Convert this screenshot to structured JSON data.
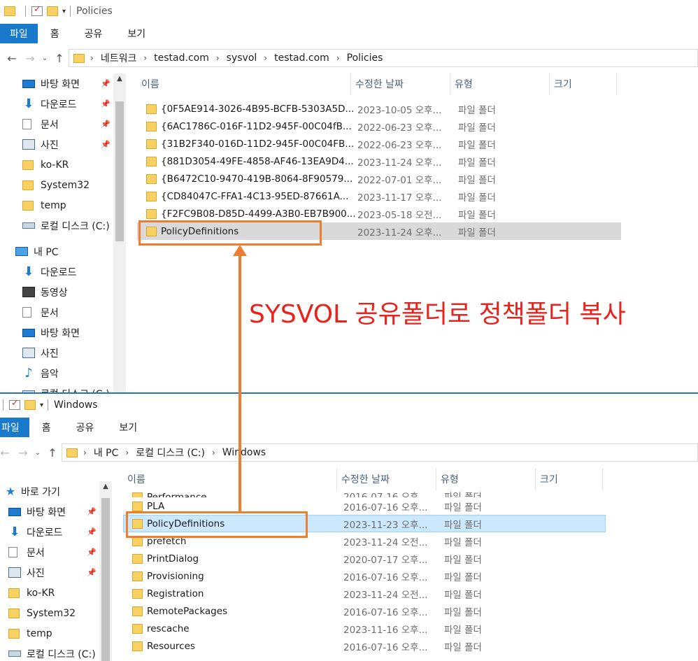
{
  "top": {
    "title": "Policies",
    "ribbon_tabs": [
      "파일",
      "홈",
      "공유",
      "보기"
    ],
    "breadcrumb": [
      "네트워크",
      "testad.com",
      "sysvol",
      "testad.com",
      "Policies"
    ],
    "sidebar": [
      {
        "label": "바탕 화면",
        "icon": "desktop-icon",
        "pinned": true
      },
      {
        "label": "다운로드",
        "icon": "download-icon",
        "pinned": true
      },
      {
        "label": "문서",
        "icon": "document-icon",
        "pinned": true
      },
      {
        "label": "사진",
        "icon": "pictures-icon",
        "pinned": true
      },
      {
        "label": "ko-KR",
        "icon": "folder-icon",
        "pinned": false
      },
      {
        "label": "System32",
        "icon": "folder-icon",
        "pinned": false
      },
      {
        "label": "temp",
        "icon": "folder-icon",
        "pinned": false
      },
      {
        "label": "로컬 디스크 (C:)",
        "icon": "drive-icon",
        "pinned": false
      },
      {
        "label": "내 PC",
        "icon": "pc-icon",
        "pinned": false
      },
      {
        "label": "다운로드",
        "icon": "download-icon",
        "pinned": false
      },
      {
        "label": "동영상",
        "icon": "video-icon",
        "pinned": false
      },
      {
        "label": "문서",
        "icon": "document-icon",
        "pinned": false
      },
      {
        "label": "바탕 화면",
        "icon": "desktop-icon",
        "pinned": false
      },
      {
        "label": "사진",
        "icon": "pictures-icon",
        "pinned": false
      },
      {
        "label": "음악",
        "icon": "music-icon",
        "pinned": false
      },
      {
        "label": "로컬 디스크 (C:)",
        "icon": "drive-icon",
        "pinned": false
      }
    ],
    "columns": [
      "이름",
      "수정한 날짜",
      "유형",
      "크기"
    ],
    "rows": [
      {
        "name": "{0F5AE914-3026-4B95-BCFB-5303A5D...",
        "date": "2023-10-05 오후...",
        "type": "파일 폴더"
      },
      {
        "name": "{6AC1786C-016F-11D2-945F-00C04fB...",
        "date": "2022-06-23 오후...",
        "type": "파일 폴더"
      },
      {
        "name": "{31B2F340-016D-11D2-945F-00C04FB...",
        "date": "2022-06-23 오후...",
        "type": "파일 폴더"
      },
      {
        "name": "{881D3054-49FE-4858-AF46-13EA9D4...",
        "date": "2023-11-24 오후...",
        "type": "파일 폴더"
      },
      {
        "name": "{B6472C10-9470-419B-8064-8F90579...",
        "date": "2022-07-01 오후...",
        "type": "파일 폴더"
      },
      {
        "name": "{CD84047C-FFA1-4C13-95ED-87661A...",
        "date": "2023-11-17 오후...",
        "type": "파일 폴더"
      },
      {
        "name": "{F2FC9B08-D85D-4499-A3B0-EB7B900...",
        "date": "2023-05-18 오전...",
        "type": "파일 폴더"
      },
      {
        "name": "PolicyDefinitions",
        "date": "2023-11-24 오후...",
        "type": "파일 폴더",
        "selected": true
      }
    ]
  },
  "bottom": {
    "title": "Windows",
    "ribbon_tabs": [
      "파일",
      "홈",
      "공유",
      "보기"
    ],
    "breadcrumb": [
      "내 PC",
      "로컬 디스크 (C:)",
      "Windows"
    ],
    "sidebar": [
      {
        "label": "바로 가기",
        "icon": "star-icon",
        "pinned": false
      },
      {
        "label": "바탕 화면",
        "icon": "desktop-icon",
        "pinned": true
      },
      {
        "label": "다운로드",
        "icon": "download-icon",
        "pinned": true
      },
      {
        "label": "문서",
        "icon": "document-icon",
        "pinned": true
      },
      {
        "label": "사진",
        "icon": "pictures-icon",
        "pinned": true
      },
      {
        "label": "ko-KR",
        "icon": "folder-icon",
        "pinned": false
      },
      {
        "label": "System32",
        "icon": "folder-icon",
        "pinned": false
      },
      {
        "label": "temp",
        "icon": "folder-icon",
        "pinned": false
      },
      {
        "label": "로컬 디스크 (C:)",
        "icon": "drive-icon",
        "pinned": false
      }
    ],
    "columns": [
      "이름",
      "수정한 날짜",
      "유형",
      "크기"
    ],
    "rows": [
      {
        "name": "Performance",
        "date": "2016-07-16 오후...",
        "type": "파일 폴더",
        "partial": true
      },
      {
        "name": "PLA",
        "date": "2016-07-16 오후...",
        "type": "파일 폴더"
      },
      {
        "name": "PolicyDefinitions",
        "date": "2023-11-23 오후...",
        "type": "파일 폴더",
        "selected": true
      },
      {
        "name": "prefetch",
        "date": "2023-11-24 오전...",
        "type": "파일 폴더"
      },
      {
        "name": "PrintDialog",
        "date": "2020-07-17 오후...",
        "type": "파일 폴더"
      },
      {
        "name": "Provisioning",
        "date": "2016-07-16 오후...",
        "type": "파일 폴더"
      },
      {
        "name": "Registration",
        "date": "2023-11-24 오전...",
        "type": "파일 폴더"
      },
      {
        "name": "RemotePackages",
        "date": "2016-07-16 오후...",
        "type": "파일 폴더"
      },
      {
        "name": "rescache",
        "date": "2023-11-16 오후...",
        "type": "파일 폴더"
      },
      {
        "name": "Resources",
        "date": "2016-07-16 오후...",
        "type": "파일 폴더"
      }
    ]
  },
  "annotation": "SYSVOL 공유폴더로 정책폴더 복사",
  "colors": {
    "accent_blue": "#1979ca",
    "highlight_orange": "#ed7d31",
    "annotation_red": "#e8221c"
  }
}
